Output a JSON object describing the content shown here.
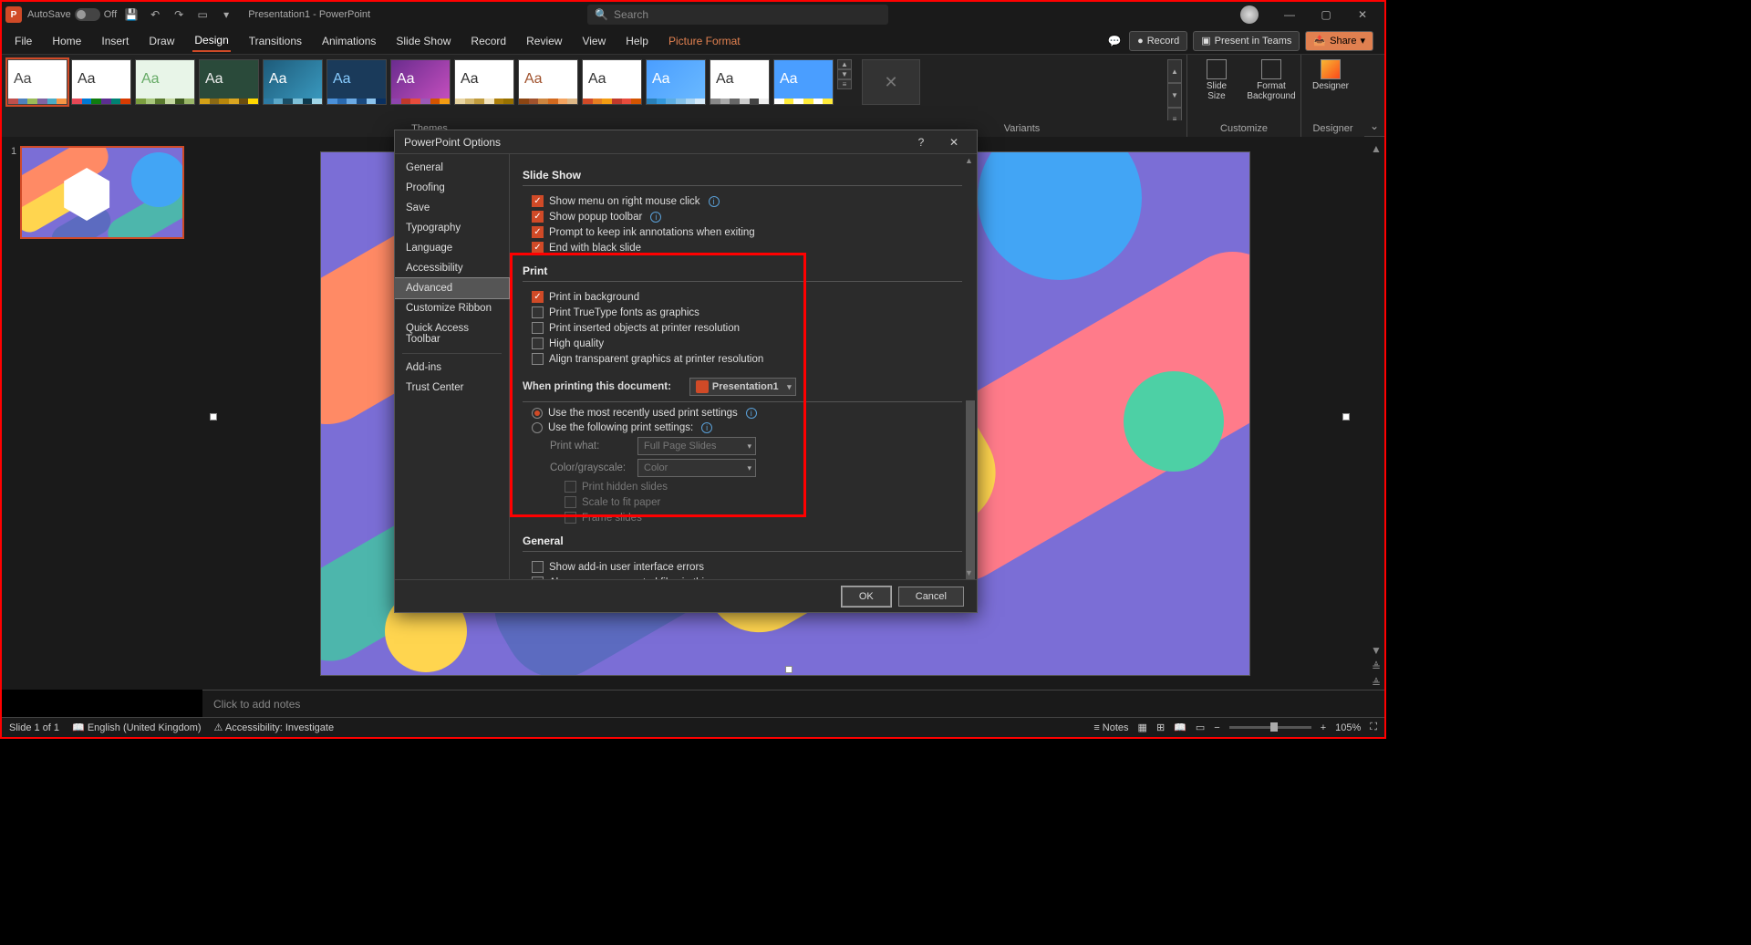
{
  "title": {
    "autosave_label": "AutoSave",
    "autosave_state": "Off",
    "doc_title": "Presentation1 - PowerPoint",
    "search_placeholder": "Search"
  },
  "tabs": {
    "file": "File",
    "home": "Home",
    "insert": "Insert",
    "draw": "Draw",
    "design": "Design",
    "transitions": "Transitions",
    "animations": "Animations",
    "slideshow": "Slide Show",
    "record": "Record",
    "review": "Review",
    "view": "View",
    "help": "Help",
    "picfmt": "Picture Format"
  },
  "ribbon_right": {
    "record": "Record",
    "present": "Present in Teams",
    "share": "Share"
  },
  "ribbon": {
    "themes_label": "Themes",
    "variants_label": "Variants",
    "customize_label": "Customize",
    "designer_group": "Designer",
    "slide_size": "Slide\nSize",
    "format_bg": "Format\nBackground",
    "designer": "Designer"
  },
  "slide_panel": {
    "num1": "1"
  },
  "notes": {
    "placeholder": "Click to add notes"
  },
  "status": {
    "slide": "Slide 1 of 1",
    "lang": "English (United Kingdom)",
    "access": "Accessibility: Investigate",
    "notes": "Notes",
    "zoom": "105%"
  },
  "dialog": {
    "title": "PowerPoint Options",
    "nav": {
      "general": "General",
      "proofing": "Proofing",
      "save": "Save",
      "typography": "Typography",
      "language": "Language",
      "accessibility": "Accessibility",
      "advanced": "Advanced",
      "custribbon": "Customize Ribbon",
      "qat": "Quick Access Toolbar",
      "addins": "Add-ins",
      "trust": "Trust Center"
    },
    "sections": {
      "slideshow": "Slide Show",
      "print": "Print",
      "general": "General"
    },
    "slideshow": {
      "menu_right": "Show menu on right mouse click",
      "popup": "Show popup toolbar",
      "prompt_ink": "Prompt to keep ink annotations when exiting",
      "end_black": "End with black slide"
    },
    "print": {
      "bg": "Print in background",
      "truetype": "Print TrueType fonts as graphics",
      "inserted": "Print inserted objects at printer resolution",
      "hq": "High quality",
      "align": "Align transparent graphics at printer resolution",
      "when_label": "When printing this document:",
      "doc_name": "Presentation1",
      "recent": "Use the most recently used print settings",
      "following": "Use the following print settings:",
      "print_what_lbl": "Print what:",
      "print_what_val": "Full Page Slides",
      "color_lbl": "Color/grayscale:",
      "color_val": "Color",
      "hidden": "Print hidden slides",
      "scale": "Scale to fit paper",
      "frame": "Frame slides"
    },
    "general": {
      "addin_err": "Show add-in user interface errors",
      "encrypted": "Always open encrypted files in this app"
    },
    "buttons": {
      "ok": "OK",
      "cancel": "Cancel"
    }
  }
}
